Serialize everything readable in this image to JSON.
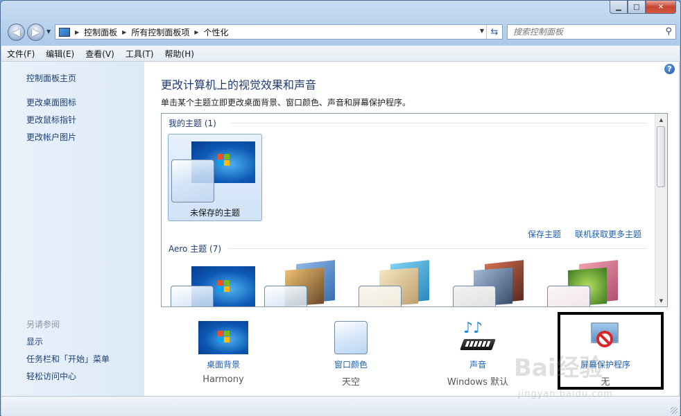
{
  "window": {
    "minimize": "▁",
    "maximize": "□",
    "close": "✕"
  },
  "nav": {
    "back": "◀",
    "forward": "▶"
  },
  "breadcrumb": [
    "控制面板",
    "所有控制面板项",
    "个性化"
  ],
  "search": {
    "placeholder": "搜索控制面板"
  },
  "menu": [
    "文件(F)",
    "编辑(E)",
    "查看(V)",
    "工具(T)",
    "帮助(H)"
  ],
  "sidebar": {
    "home": "控制面板主页",
    "links": [
      "更改桌面图标",
      "更改鼠标指针",
      "更改帐户图片"
    ],
    "see_also_title": "另请参阅",
    "see_also": [
      "显示",
      "任务栏和「开始」菜单",
      "轻松访问中心"
    ]
  },
  "main": {
    "title": "更改计算机上的视觉效果和声音",
    "description": "单击某个主题立即更改桌面背景、窗口颜色、声音和屏幕保护程序。",
    "my_themes_header": "我的主题 (1)",
    "unsaved_theme": "未保存的主题",
    "save_theme": "保存主题",
    "get_more_themes": "联机获取更多主题",
    "aero_header": "Aero 主题 (7)"
  },
  "settings": [
    {
      "label": "桌面背景",
      "value": "Harmony"
    },
    {
      "label": "窗口颜色",
      "value": "天空"
    },
    {
      "label": "声音",
      "value": "Windows 默认"
    },
    {
      "label": "屏幕保护程序",
      "value": "无"
    }
  ],
  "watermark": {
    "brand": "Bai经验",
    "url": "jingyan.baidu.com"
  },
  "colors": {
    "link": "#1b5fb5",
    "title": "#1e3a73",
    "highlight_border": "#000000"
  }
}
